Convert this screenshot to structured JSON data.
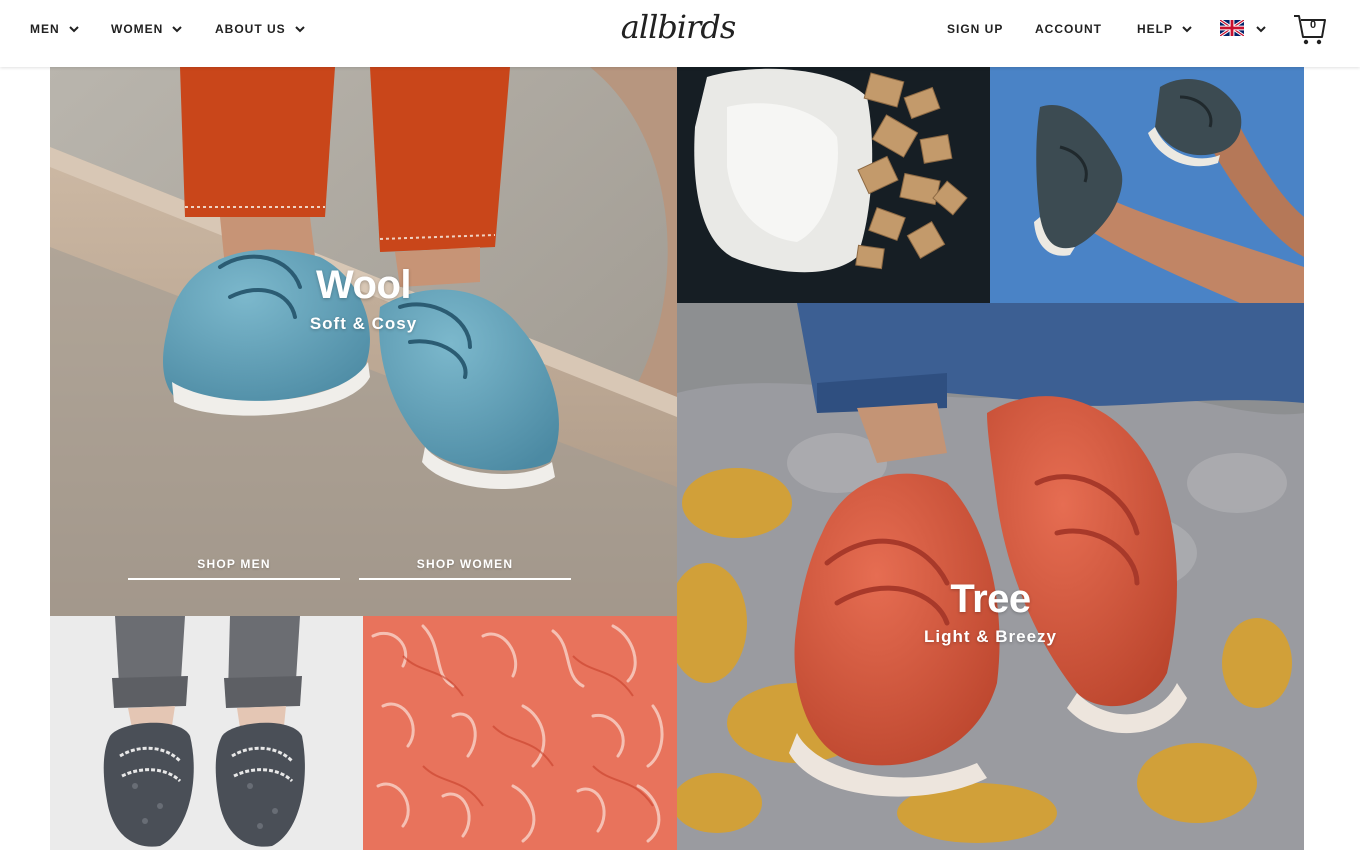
{
  "brand": {
    "logo_text": "allbirds"
  },
  "nav": {
    "left": [
      {
        "label": "MEN"
      },
      {
        "label": "WOMEN"
      },
      {
        "label": "ABOUT US"
      }
    ],
    "right": {
      "signup": "SIGN UP",
      "account": "ACCOUNT",
      "help": "HELP"
    },
    "region_icon": "uk-flag-icon",
    "cart_count": "0"
  },
  "tiles": {
    "wool": {
      "title": "Wool",
      "subtitle": "Soft & Cosy",
      "shop_men": "SHOP MEN",
      "shop_women": "SHOP WOMEN"
    },
    "tree": {
      "title": "Tree",
      "subtitle": "Light & Breezy"
    }
  },
  "colors": {
    "text": "#212121",
    "wool_shoe": "#5b9db5",
    "tree_shoe": "#d9583f",
    "sky": "#4a83c6",
    "fluff": "#e86f5a"
  }
}
